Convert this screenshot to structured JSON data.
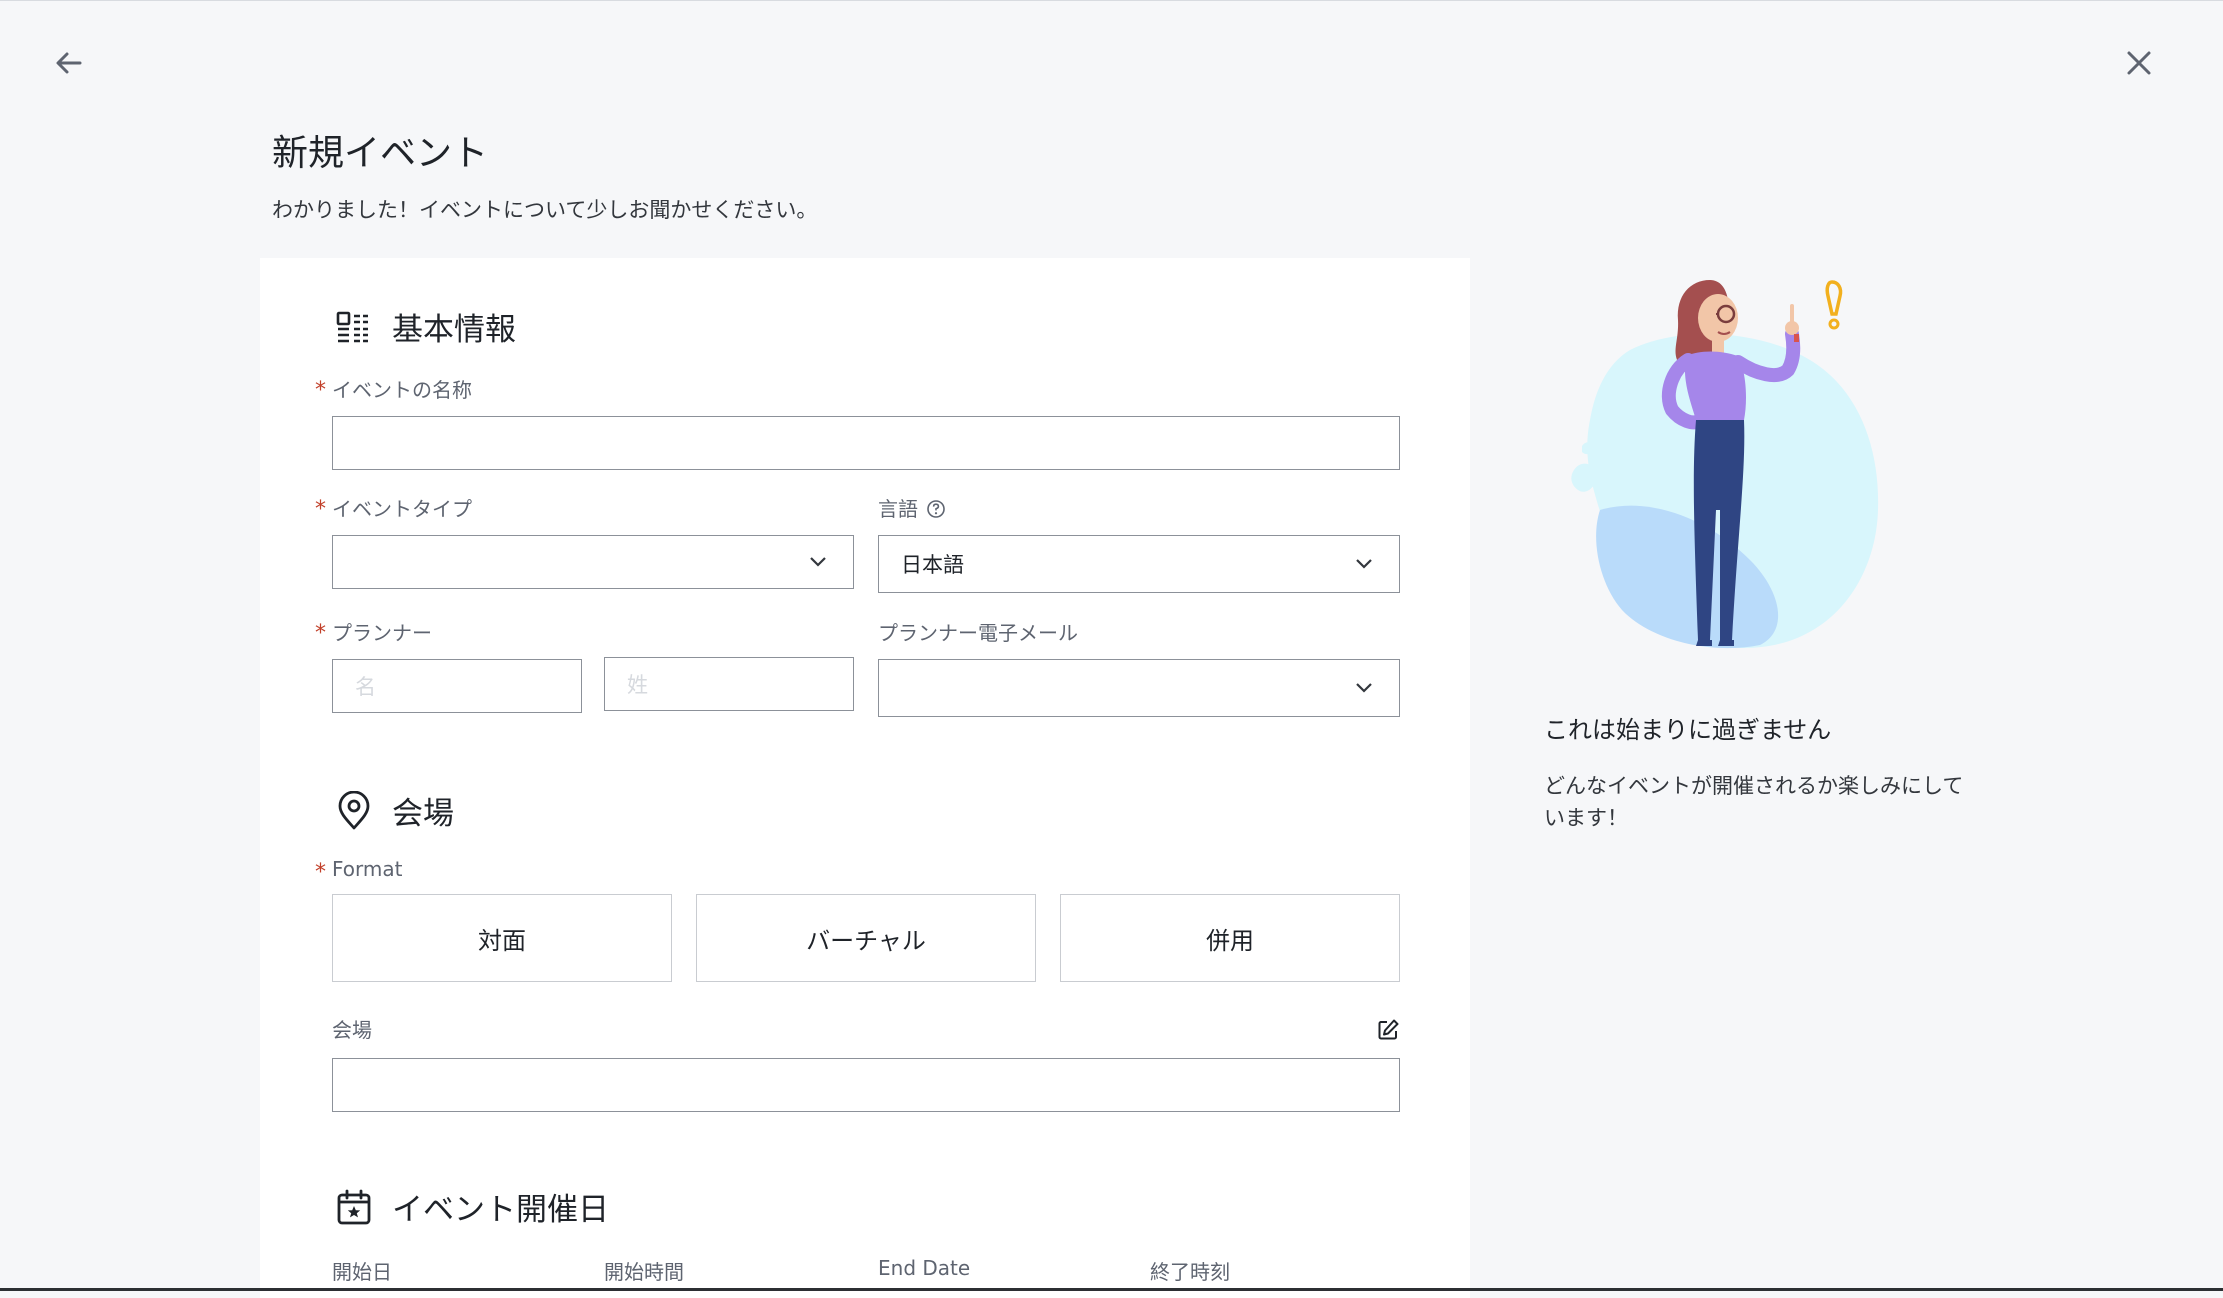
{
  "nav": {
    "back_icon": "arrow-left-icon",
    "close_icon": "close-icon"
  },
  "header": {
    "title": "新規イベント",
    "subtitle": "わかりました！イベントについて少しお聞かせください。"
  },
  "sections": {
    "basic": {
      "title": "基本情報",
      "icon": "profile-card-icon",
      "event_name_label": "イベントの名称",
      "event_name_value": "",
      "event_type_label": "イベントタイプ",
      "event_type_value": "",
      "language_label": "言語",
      "language_value": "日本語",
      "planner_label": "プランナー",
      "planner_first_placeholder": "名",
      "planner_last_placeholder": "姓",
      "planner_email_label": "プランナー電子メール",
      "planner_email_value": ""
    },
    "venue": {
      "title": "会場",
      "icon": "location-pin-icon",
      "format_label": "Format",
      "format_options": [
        "対面",
        "バーチャル",
        "併用"
      ],
      "venue_label": "会場",
      "venue_value": ""
    },
    "dates": {
      "title": "イベント開催日",
      "icon": "calendar-star-icon",
      "start_date_label": "開始日",
      "start_time_label": "開始時間",
      "end_date_label": "End Date",
      "end_time_label": "終了時刻"
    }
  },
  "aside": {
    "title": "これは始まりに過ぎません",
    "text": "どんなイベントが開催されるか楽しみにしています！"
  },
  "colors": {
    "required": "#c2402a",
    "border": "#8c9199",
    "background": "#f6f7f9",
    "card": "#ffffff"
  }
}
